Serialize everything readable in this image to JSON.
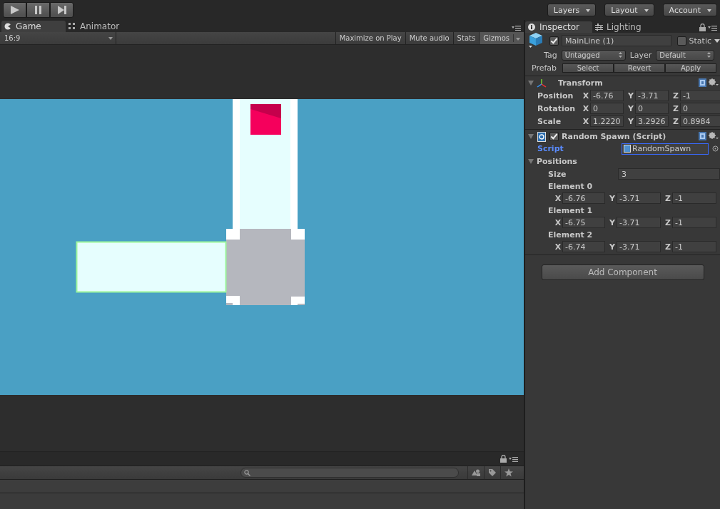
{
  "toolbar": {
    "playback_buttons": [
      {
        "kind": "play"
      },
      {
        "kind": "pause"
      },
      {
        "kind": "step"
      }
    ],
    "dropdowns": [
      "Layers",
      "Layout",
      "Account"
    ]
  },
  "game_panel": {
    "tabs": [
      {
        "label": "Game",
        "kind": "game",
        "selected": true
      },
      {
        "label": "Animator",
        "kind": "animator",
        "selected": false
      }
    ],
    "aspect": "16:9",
    "buttons": [
      {
        "label": "Maximize on Play",
        "on": false
      },
      {
        "label": "Mute audio",
        "on": false
      },
      {
        "label": "Stats",
        "on": false
      },
      {
        "label": "Gizmos",
        "on": true
      }
    ]
  },
  "inspector": {
    "tabs": [
      {
        "label": "Inspector",
        "kind": "info",
        "selected": true
      },
      {
        "label": "Lighting",
        "kind": "lighting",
        "selected": false
      }
    ],
    "object": {
      "active": true,
      "name": "MainLine (1)",
      "static_label": "Static",
      "static": false
    },
    "tag_label": "Tag",
    "tag": "Untagged",
    "layer_label": "Layer",
    "layer": "Default",
    "prefab_label": "Prefab",
    "prefab_buttons": [
      "Select",
      "Revert",
      "Apply"
    ],
    "transform": {
      "title": "Transform",
      "expanded": true,
      "rows": [
        {
          "label": "Position",
          "values": [
            {
              "axis": "X",
              "value": "-6.76"
            },
            {
              "axis": "Y",
              "value": "-3.71"
            },
            {
              "axis": "Z",
              "value": "-1"
            }
          ]
        },
        {
          "label": "Rotation",
          "values": [
            {
              "axis": "X",
              "value": "0"
            },
            {
              "axis": "Y",
              "value": "0"
            },
            {
              "axis": "Z",
              "value": "0"
            }
          ]
        },
        {
          "label": "Scale",
          "values": [
            {
              "axis": "X",
              "value": "1.2220"
            },
            {
              "axis": "Y",
              "value": "3.2926"
            },
            {
              "axis": "Z",
              "value": "0.8984"
            }
          ]
        }
      ]
    },
    "script_component": {
      "title": "Random Spawn (Script)",
      "expanded": true,
      "enabled": true,
      "script_label": "Script",
      "script": "RandomSpawn",
      "positions": {
        "label": "Positions",
        "expanded": true,
        "size_label": "Size",
        "size": "3",
        "elements": [
          {
            "label": "Element 0",
            "values": [
              {
                "axis": "X",
                "value": "-6.76"
              },
              {
                "axis": "Y",
                "value": "-3.71"
              },
              {
                "axis": "Z",
                "value": "-1"
              }
            ]
          },
          {
            "label": "Element 1",
            "values": [
              {
                "axis": "X",
                "value": "-6.75"
              },
              {
                "axis": "Y",
                "value": "-3.71"
              },
              {
                "axis": "Z",
                "value": "-1"
              }
            ]
          },
          {
            "label": "Element 2",
            "values": [
              {
                "axis": "X",
                "value": "-6.74"
              },
              {
                "axis": "Y",
                "value": "-3.71"
              },
              {
                "axis": "Z",
                "value": "-1"
              }
            ]
          }
        ]
      }
    },
    "add_component": "Add Component"
  }
}
